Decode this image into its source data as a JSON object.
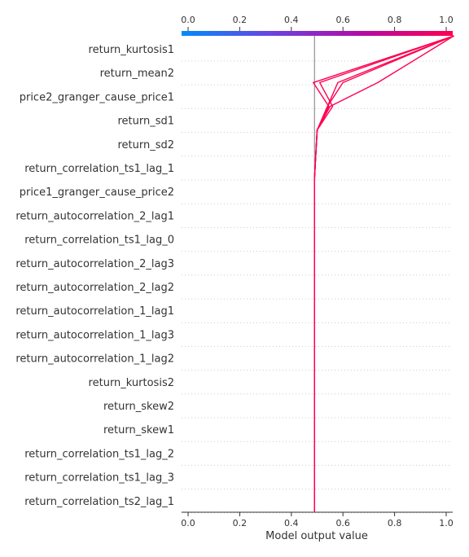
{
  "chart_data": {
    "type": "line",
    "xlabel": "Model output value",
    "xlim": [
      0.0,
      1.0
    ],
    "xticks": [
      0.0,
      0.2,
      0.4,
      0.6,
      0.8,
      1.0
    ],
    "xtick_labels": [
      "0.0",
      "0.2",
      "0.4",
      "0.6",
      "0.8",
      "1.0"
    ],
    "top_xtick_labels": [
      "0.0",
      "0.2",
      "0.4",
      "0.6",
      "0.8",
      "1.0"
    ],
    "base_value": 0.49,
    "features": [
      "return_kurtosis1",
      "return_mean2",
      "price2_granger_cause_price1",
      "return_sd1",
      "return_sd2",
      "return_correlation_ts1_lag_1",
      "price1_granger_cause_price2",
      "return_autocorrelation_2_lag1",
      "return_correlation_ts1_lag_0",
      "return_autocorrelation_2_lag3",
      "return_autocorrelation_2_lag2",
      "return_autocorrelation_1_lag1",
      "return_autocorrelation_1_lag3",
      "return_autocorrelation_1_lag2",
      "return_kurtosis2",
      "return_skew2",
      "return_skew1",
      "return_correlation_ts1_lag_2",
      "return_correlation_ts1_lag_3",
      "return_correlation_ts2_lag_1"
    ],
    "series": [
      {
        "values": [
          0.49,
          0.49,
          0.49,
          0.49,
          0.49,
          0.49,
          0.49,
          0.49,
          0.49,
          0.49,
          0.49,
          0.49,
          0.49,
          0.49,
          0.49,
          0.495,
          0.5,
          0.56,
          0.51,
          1.03
        ]
      },
      {
        "values": [
          0.49,
          0.49,
          0.49,
          0.49,
          0.49,
          0.49,
          0.49,
          0.49,
          0.49,
          0.49,
          0.49,
          0.49,
          0.49,
          0.49,
          0.49,
          0.495,
          0.5,
          0.545,
          0.485,
          1.03
        ]
      },
      {
        "values": [
          0.49,
          0.49,
          0.49,
          0.49,
          0.49,
          0.49,
          0.49,
          0.49,
          0.49,
          0.49,
          0.49,
          0.49,
          0.49,
          0.49,
          0.49,
          0.495,
          0.5,
          0.54,
          0.58,
          1.03
        ]
      },
      {
        "values": [
          0.49,
          0.49,
          0.49,
          0.49,
          0.49,
          0.49,
          0.49,
          0.49,
          0.49,
          0.49,
          0.49,
          0.49,
          0.49,
          0.49,
          0.49,
          0.495,
          0.5,
          0.54,
          0.6,
          1.03
        ]
      },
      {
        "values": [
          0.49,
          0.49,
          0.49,
          0.49,
          0.49,
          0.49,
          0.49,
          0.49,
          0.49,
          0.49,
          0.49,
          0.49,
          0.49,
          0.49,
          0.49,
          0.495,
          0.5,
          0.55,
          0.735,
          1.03
        ]
      }
    ],
    "colorbar": {
      "range": [
        0.0,
        1.0
      ],
      "colors": [
        "#008bfb",
        "#6a44e0",
        "#b40aa6",
        "#ff0051"
      ]
    },
    "line_color": "#ff0051",
    "base_line_color": "#999999",
    "grid": "horizontal-dotted"
  }
}
